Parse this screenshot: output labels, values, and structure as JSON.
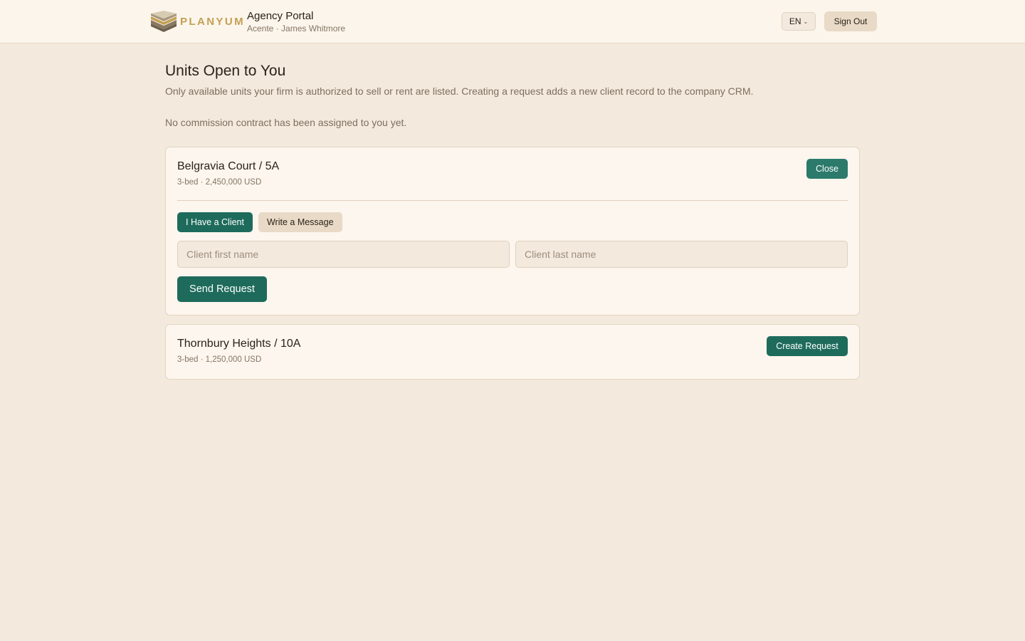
{
  "header": {
    "brand": "PLANYUM",
    "portal_title": "Agency Portal",
    "portal_subtitle": "Acente · James Whitmore",
    "language": "EN",
    "sign_out": "Sign Out"
  },
  "page": {
    "title": "Units Open to You",
    "description": "Only available units your firm is authorized to sell or rent are listed. Creating a request adds a new client record to the company CRM.",
    "notice": "No commission contract has been assigned to you yet."
  },
  "units": [
    {
      "title": "Belgravia Court / 5A",
      "meta": "3-bed · 2,450,000 USD",
      "action": "Close",
      "tab_client": "I Have a Client",
      "tab_message": "Write a Message",
      "first_name_placeholder": "Client first name",
      "last_name_placeholder": "Client last name",
      "send": "Send Request"
    },
    {
      "title": "Thornbury Heights / 10A",
      "meta": "3-bed · 1,250,000 USD",
      "action": "Create Request"
    }
  ],
  "colors": {
    "background": "#f3e9dd",
    "accent": "#1e6b5c",
    "brand_gold": "#c4a052"
  },
  "icons": {
    "logo": "stacked-layers-logo-icon",
    "language_dropdown": "chevron-down-icon"
  }
}
